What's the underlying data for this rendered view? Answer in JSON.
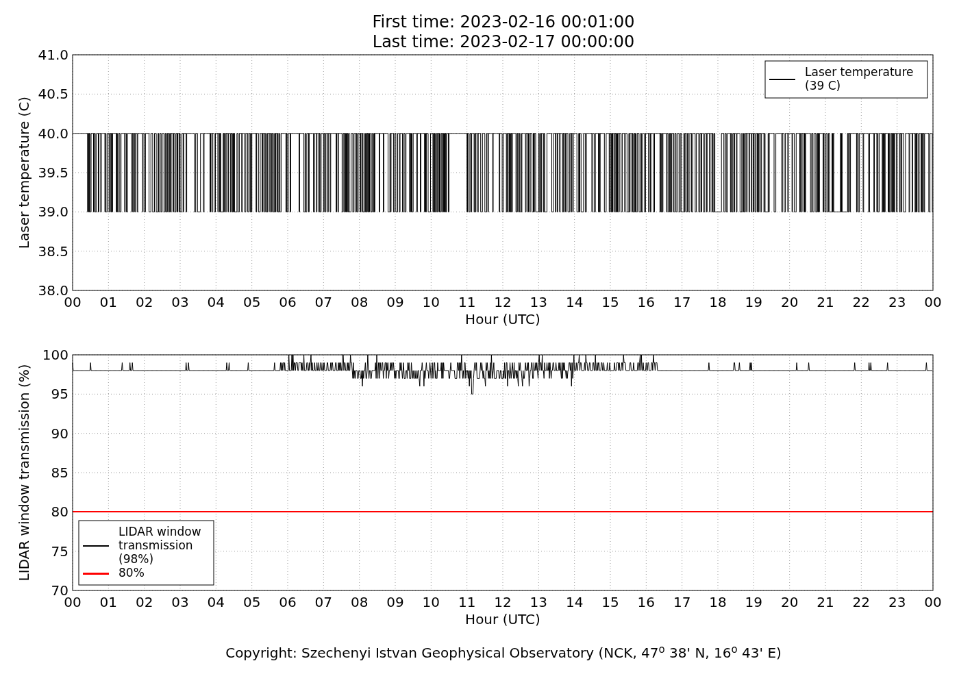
{
  "title": [
    "First time: 2023-02-16 00:01:00",
    "Last time: 2023-02-17 00:00:00"
  ],
  "charts": [
    {
      "kind": "temperature",
      "ylabel": "Laser temperature (C)",
      "xlabel": "Hour (UTC)",
      "yticks": [
        "41.0",
        "40.5",
        "40.0",
        "39.5",
        "39.0",
        "38.5",
        "38.0"
      ],
      "xticks": [
        "00",
        "01",
        "02",
        "03",
        "04",
        "05",
        "06",
        "07",
        "08",
        "09",
        "10",
        "11",
        "12",
        "13",
        "14",
        "15",
        "16",
        "17",
        "18",
        "19",
        "20",
        "21",
        "22",
        "23",
        "00"
      ],
      "legend": [
        {
          "lines": [
            "Laser temperature",
            "(39 C)"
          ],
          "color": "#000000",
          "kind": "signal"
        }
      ]
    },
    {
      "kind": "transmission",
      "ylabel": "LIDAR window transmission (%)",
      "xlabel": "Hour (UTC)",
      "yticks": [
        "100",
        "95",
        "90",
        "85",
        "80",
        "75",
        "70"
      ],
      "xticks": [
        "00",
        "01",
        "02",
        "03",
        "04",
        "05",
        "06",
        "07",
        "08",
        "09",
        "10",
        "11",
        "12",
        "13",
        "14",
        "15",
        "16",
        "17",
        "18",
        "19",
        "20",
        "21",
        "22",
        "23",
        "00"
      ],
      "legend": [
        {
          "lines": [
            "LIDAR window",
            "transmission",
            "(98%)"
          ],
          "color": "#000000",
          "kind": "signal"
        },
        {
          "lines": [
            "80%"
          ],
          "color": "#ff0000",
          "kind": "threshold"
        }
      ]
    }
  ],
  "copyright": "Copyright: Szechenyi Istvan Geophysical Observatory (NCK, 47$^{o}$ 38' N, 16$^{o}$ 43' E)"
}
